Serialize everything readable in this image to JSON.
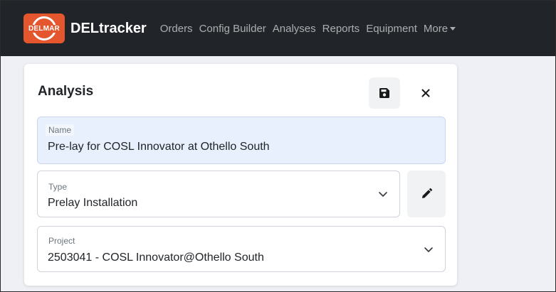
{
  "app": {
    "brand": "DELtracker",
    "logo_text": "DELMAR"
  },
  "nav": {
    "items": [
      {
        "label": "Orders"
      },
      {
        "label": "Config Builder"
      },
      {
        "label": "Analyses"
      },
      {
        "label": "Reports"
      },
      {
        "label": "Equipment"
      }
    ],
    "more_label": "More"
  },
  "card": {
    "title": "Analysis",
    "save_icon": "floppy-disk-icon",
    "close_icon": "close-icon",
    "name": {
      "label": "Name",
      "value": "Pre-lay for COSL Innovator at Othello South"
    },
    "type": {
      "label": "Type",
      "value": "Prelay Installation",
      "edit_icon": "pencil-icon"
    },
    "project": {
      "label": "Project",
      "value": "2503041 - COSL Innovator@Othello South"
    }
  },
  "colors": {
    "navbar_bg": "#212529",
    "logo_bg": "#e4572e",
    "page_bg": "#eef0f5",
    "name_field_bg": "#e8f0fe"
  }
}
